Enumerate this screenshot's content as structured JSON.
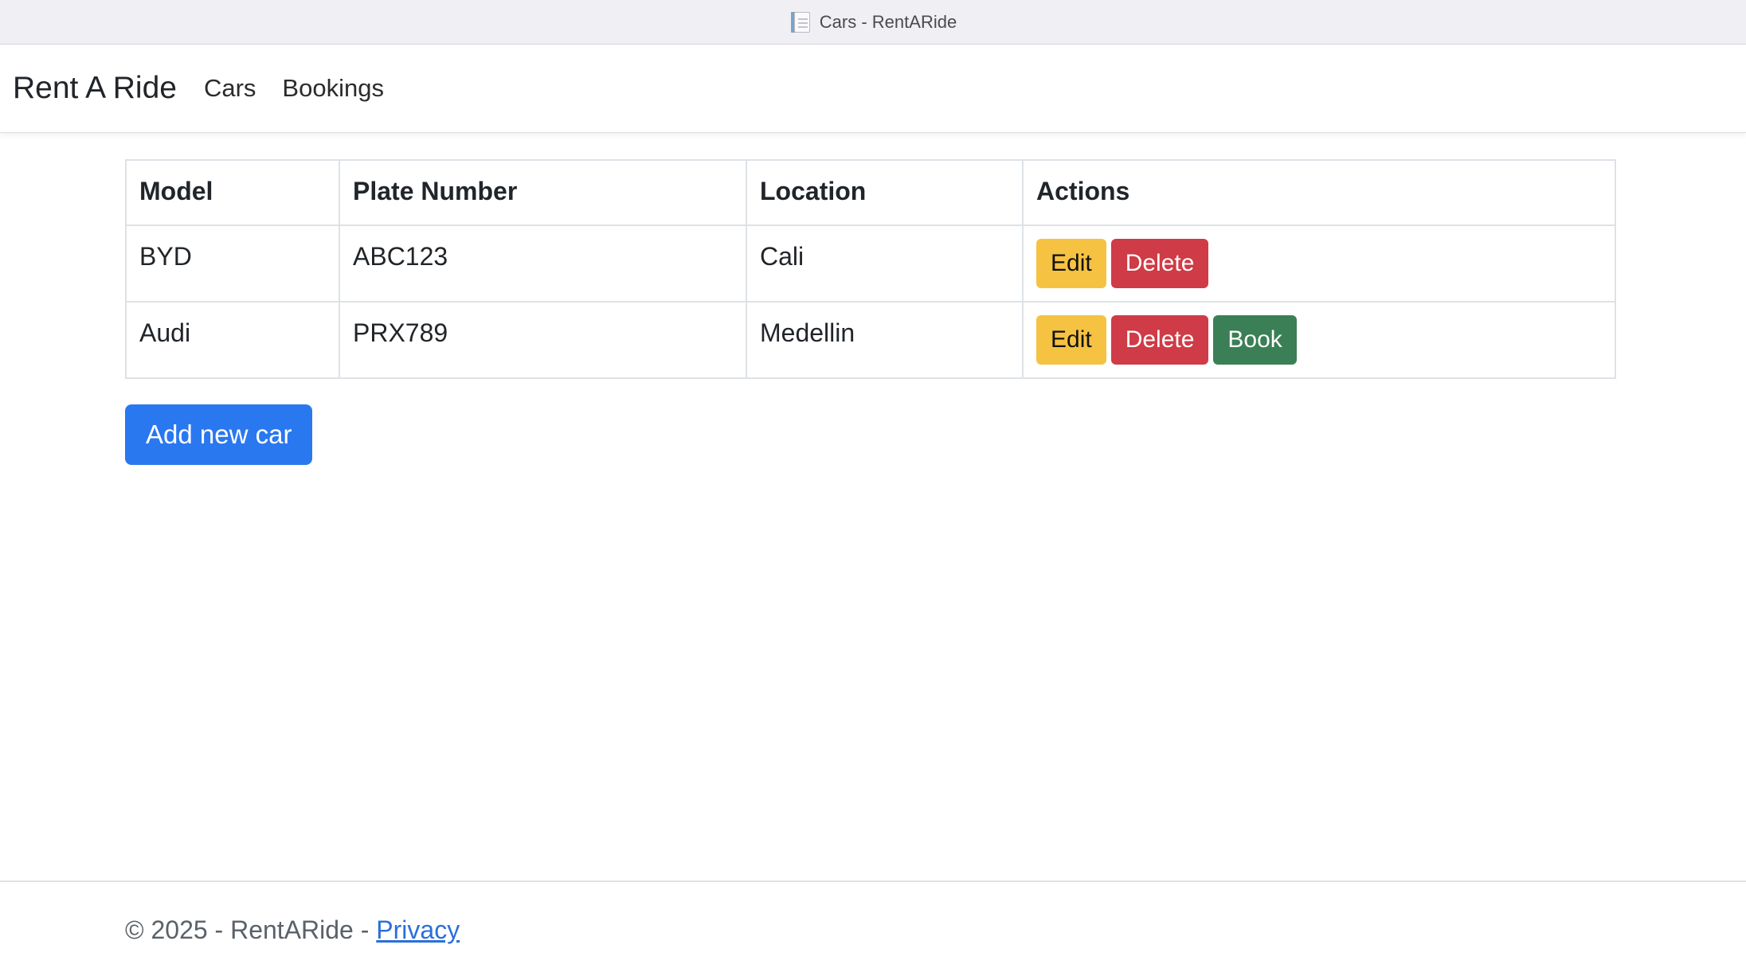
{
  "window": {
    "title": "Cars - RentARide"
  },
  "navbar": {
    "brand": "Rent A Ride",
    "links": [
      "Cars",
      "Bookings"
    ]
  },
  "table": {
    "headers": [
      "Model",
      "Plate Number",
      "Location",
      "Actions"
    ],
    "rows": [
      {
        "model": "BYD",
        "plate": "ABC123",
        "location": "Cali",
        "actions": [
          "Edit",
          "Delete"
        ]
      },
      {
        "model": "Audi",
        "plate": "PRX789",
        "location": "Medellin",
        "actions": [
          "Edit",
          "Delete",
          "Book"
        ]
      }
    ]
  },
  "add_button": "Add new car",
  "footer": {
    "text": "© 2025 - RentARide - ",
    "link": "Privacy"
  },
  "colors": {
    "edit": "#f5c242",
    "delete": "#cf3b46",
    "book": "#3b7f56",
    "primary": "#2a78f0",
    "link": "#2a6fdb"
  },
  "icons": {
    "title_icon": "document-icon"
  }
}
